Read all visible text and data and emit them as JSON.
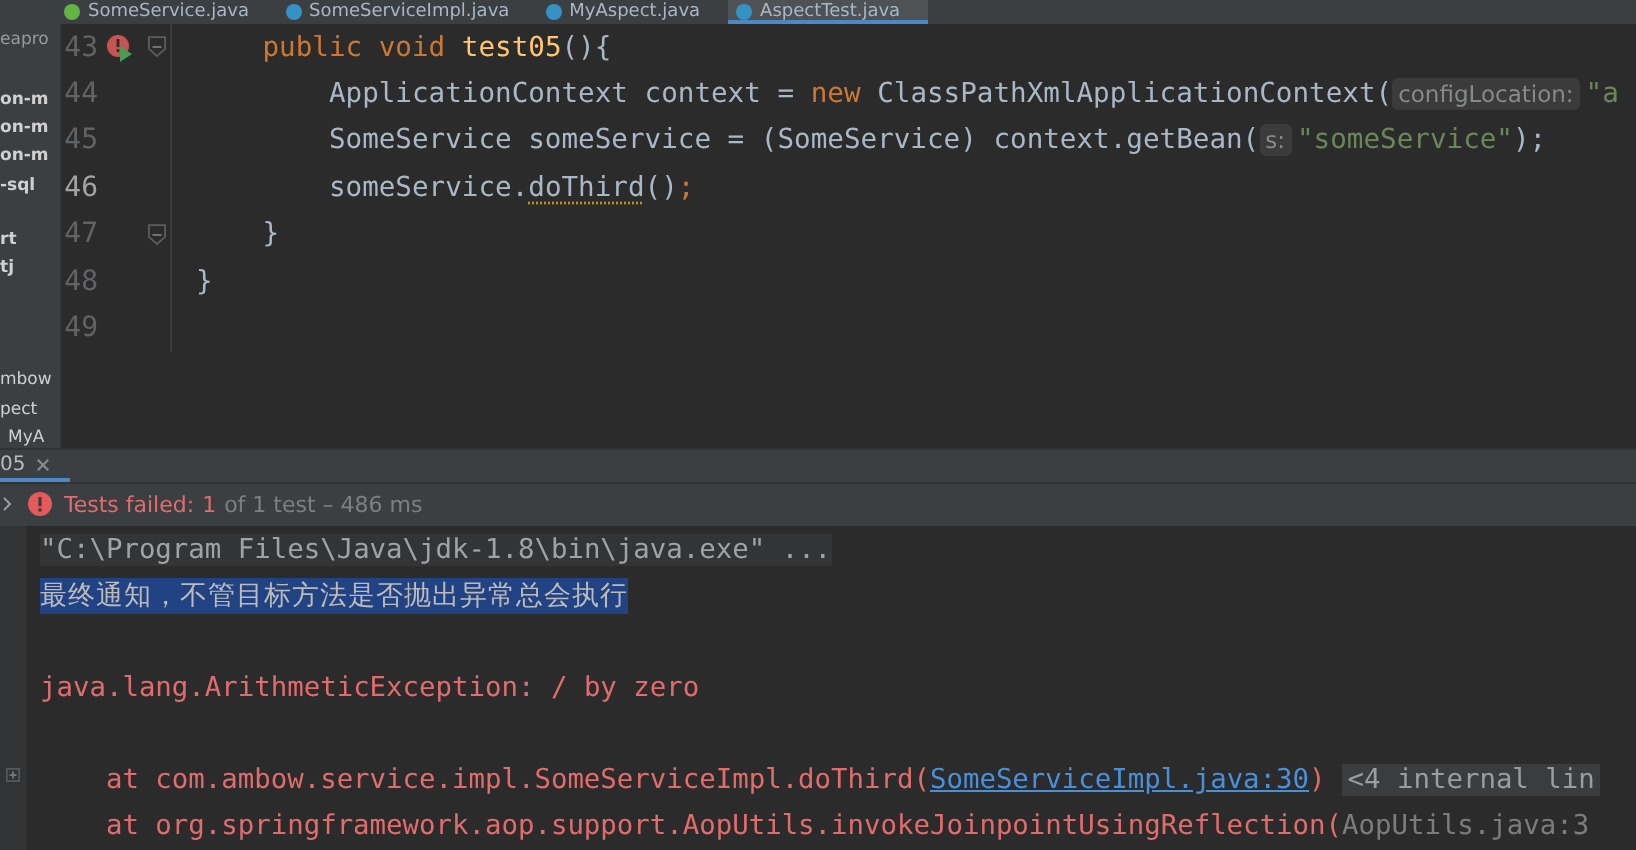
{
  "editor_tabs": [
    {
      "label": "SomeService.java",
      "kind": "interface",
      "selected": false
    },
    {
      "label": "SomeServiceImpl.java",
      "kind": "class",
      "selected": false
    },
    {
      "label": "MyAspect.java",
      "kind": "class",
      "selected": false
    },
    {
      "label": "AspectTest.java",
      "kind": "class",
      "selected": true
    }
  ],
  "project_tree": [
    "eapro",
    "on-m",
    "on-m",
    "on-m",
    "-sql",
    "rt",
    "tj",
    "mbow",
    "pect",
    "MyA"
  ],
  "code_lines": [
    {
      "number": "43",
      "current": false,
      "run_marker": true,
      "fold": true,
      "segments": [
        {
          "kind": "keyword",
          "text": "    public void "
        },
        {
          "kind": "decl",
          "text": "test05"
        },
        {
          "kind": "plain",
          "text": "(){"
        }
      ]
    },
    {
      "number": "44",
      "current": false,
      "run_marker": false,
      "fold": false,
      "segments": [
        {
          "kind": "plain",
          "text": "        ApplicationContext context = "
        },
        {
          "kind": "keyword",
          "text": "new "
        },
        {
          "kind": "plain",
          "text": "ClassPathXmlApplicationContext("
        },
        {
          "kind": "hint",
          "text": "configLocation:"
        },
        {
          "kind": "string",
          "text": "\"a"
        }
      ]
    },
    {
      "number": "45",
      "current": false,
      "run_marker": false,
      "fold": false,
      "segments": [
        {
          "kind": "plain",
          "text": "        SomeService someService = (SomeService) context.getBean("
        },
        {
          "kind": "hint",
          "text": "s:"
        },
        {
          "kind": "string",
          "text": "\"someService\""
        },
        {
          "kind": "plain",
          "text": ");"
        }
      ]
    },
    {
      "number": "46",
      "current": true,
      "run_marker": false,
      "fold": false,
      "segments": [
        {
          "kind": "plain",
          "text": "        someService."
        },
        {
          "kind": "warning",
          "text": "doThird"
        },
        {
          "kind": "plain",
          "text": "()"
        },
        {
          "kind": "keyword",
          "text": ";"
        }
      ]
    },
    {
      "number": "47",
      "current": false,
      "run_marker": false,
      "fold": true,
      "segments": [
        {
          "kind": "plain",
          "text": "    }"
        }
      ]
    },
    {
      "number": "48",
      "current": false,
      "run_marker": false,
      "fold": false,
      "segments": [
        {
          "kind": "plain",
          "text": "}"
        }
      ]
    },
    {
      "number": "49",
      "current": false,
      "run_marker": false,
      "fold": false
    }
  ],
  "run_tab": {
    "label": "05",
    "selected": true
  },
  "test_status": {
    "failed_label": "Tests failed:",
    "failed_count": "1",
    "summary": "of 1 test – 486 ms"
  },
  "console": [
    {
      "kind": "command",
      "selected": false,
      "segments": [
        {
          "kind": "text",
          "text": "\"C:\\Program Files\\Java\\jdk-1.8\\bin\\java.exe\" ..."
        }
      ]
    },
    {
      "kind": "output",
      "selected": true,
      "segments": [
        {
          "kind": "text",
          "text": "最终通知，不管目标方法是否抛出异常总会执行"
        }
      ]
    },
    {
      "kind": "error",
      "selected": false,
      "segments": [
        {
          "kind": "text",
          "text": "java.lang.ArithmeticException: / by zero"
        }
      ]
    },
    {
      "kind": "trace",
      "selected": false,
      "segments": [
        {
          "kind": "text",
          "text": "at com.ambow.service.impl.SomeServiceImpl.doThird("
        },
        {
          "kind": "link",
          "text": "SomeServiceImpl.java:30"
        },
        {
          "kind": "text",
          "text": ")"
        },
        {
          "kind": "fold",
          "text": "<4 internal lin"
        }
      ]
    },
    {
      "kind": "trace",
      "selected": false,
      "segments": [
        {
          "kind": "text",
          "text": "at org.springframework.aop.support.AopUtils.invokeJoinpointUsingReflection("
        },
        {
          "kind": "muted",
          "text": "AopUtils.java:3"
        }
      ]
    }
  ]
}
